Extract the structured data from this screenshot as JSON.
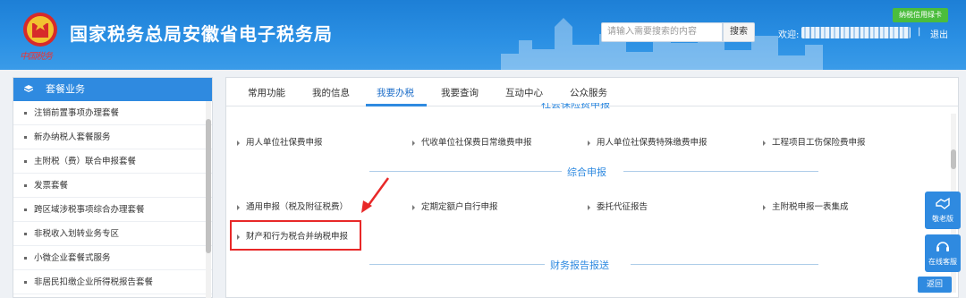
{
  "header": {
    "title": "国家税务总局安徽省电子税务局",
    "slogan": "中国税务",
    "search_placeholder": "请输入需要搜索的内容",
    "search_button": "搜索",
    "credit_card": "纳税信用绿卡",
    "welcome": "欢迎:",
    "separator": "|",
    "logout": "退出"
  },
  "sidebar": {
    "title": "套餐业务",
    "items": [
      {
        "label": "注销前置事项办理套餐"
      },
      {
        "label": "新办纳税人套餐服务"
      },
      {
        "label": "主附税（费）联合申报套餐"
      },
      {
        "label": "发票套餐"
      },
      {
        "label": "跨区域涉税事项综合办理套餐"
      },
      {
        "label": "非税收入划转业务专区"
      },
      {
        "label": "小微企业套餐式服务"
      },
      {
        "label": "非居民扣缴企业所得税报告套餐"
      }
    ]
  },
  "tabs": [
    {
      "label": "常用功能"
    },
    {
      "label": "我的信息"
    },
    {
      "label": "我要办税"
    },
    {
      "label": "我要查询"
    },
    {
      "label": "互动中心"
    },
    {
      "label": "公众服务"
    }
  ],
  "active_tab": "我要办税",
  "sections": {
    "social": {
      "title": "社会保险费申报",
      "items": [
        {
          "label": "用人单位社保费申报"
        },
        {
          "label": "代收单位社保费日常缴费申报"
        },
        {
          "label": "用人单位社保费特殊缴费申报"
        },
        {
          "label": "工程项目工伤保险费申报"
        }
      ]
    },
    "comprehensive": {
      "title": "综合申报",
      "items": [
        {
          "label": "通用申报（税及附征税费）"
        },
        {
          "label": "定期定额户自行申报"
        },
        {
          "label": "委托代征报告"
        },
        {
          "label": "主附税申报一表集成"
        },
        {
          "label": "财产和行为税合并纳税申报"
        }
      ]
    },
    "financial": {
      "title": "财务报告报送"
    }
  },
  "float_buttons": {
    "elder": "敬老版",
    "service": "在线客服",
    "back": "返回"
  },
  "colors": {
    "header_blue": "#2a8fe3",
    "accent": "#2f8ae0",
    "highlight_red": "#e82828",
    "credit_green": "#4bbd3c"
  }
}
